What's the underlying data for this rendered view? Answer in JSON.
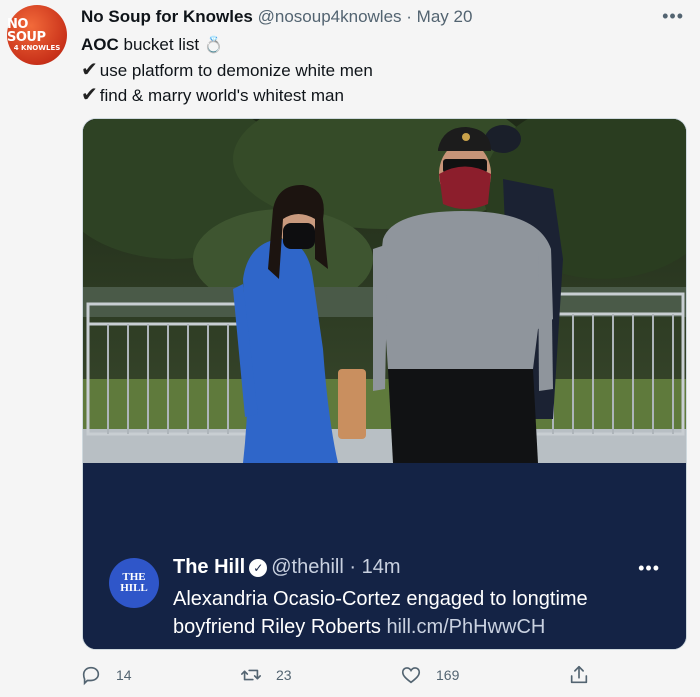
{
  "avatar": {
    "line1": "NO SOUP",
    "line2": "4 KNOWLES"
  },
  "header": {
    "name": "No Soup for Knowles",
    "handle": "@nosoup4knowles",
    "separator": "·",
    "date": "May 20",
    "more": "•••"
  },
  "tweet": {
    "line1_bold": "AOC",
    "line1_rest": " bucket list ",
    "line1_emoji": "💍",
    "check": "✔",
    "line2": "use platform to demonize white men",
    "line3": "find & marry world's whitest man"
  },
  "quote": {
    "avatar_line1": "THE",
    "avatar_line2": "HILL",
    "name": "The Hill",
    "verified": "✓",
    "handle": "@thehill",
    "separator": "·",
    "time": "14m",
    "more": "•••",
    "text": "Alexandria Ocasio-Cortez engaged to longtime boyfriend Riley Roberts ",
    "link": "hill.cm/PhHwwCH"
  },
  "actions": {
    "reply_count": "14",
    "retweet_count": "23",
    "like_count": "169"
  },
  "icons": [
    "reply-icon",
    "retweet-icon",
    "like-icon",
    "share-icon"
  ]
}
